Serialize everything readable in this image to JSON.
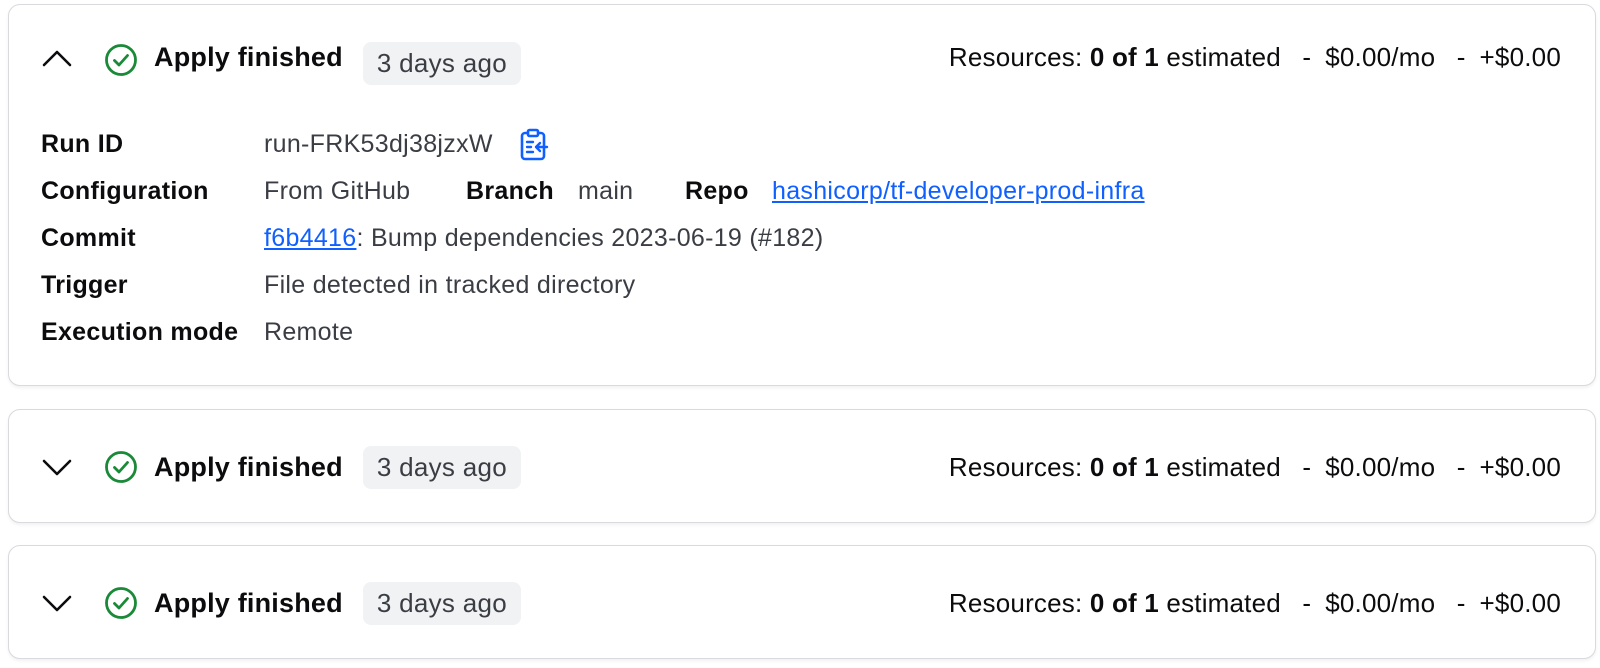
{
  "runs": [
    {
      "expanded": true,
      "status": "Apply finished",
      "time": "3 days ago",
      "resources": {
        "label": "Resources:",
        "count": "0 of 1",
        "estimated": "estimated",
        "sep": "-",
        "monthly": "$0.00/mo",
        "delta": "+$0.00"
      },
      "details": {
        "run_id_label": "Run ID",
        "run_id": "run-FRK53dj38jzxW",
        "configuration_label": "Configuration",
        "configuration": "From GitHub",
        "branch_label": "Branch",
        "branch": "main",
        "repo_label": "Repo",
        "repo": "hashicorp/tf-developer-prod-infra",
        "commit_label": "Commit",
        "commit_sha": "f6b4416",
        "commit_message": ": Bump dependencies 2023-06-19 (#182)",
        "trigger_label": "Trigger",
        "trigger": "File detected in tracked directory",
        "execution_mode_label": "Execution mode",
        "execution_mode": "Remote"
      }
    },
    {
      "expanded": false,
      "status": "Apply finished",
      "time": "3 days ago",
      "resources": {
        "label": "Resources:",
        "count": "0 of 1",
        "estimated": "estimated",
        "sep": "-",
        "monthly": "$0.00/mo",
        "delta": "+$0.00"
      }
    },
    {
      "expanded": false,
      "status": "Apply finished",
      "time": "3 days ago",
      "resources": {
        "label": "Resources:",
        "count": "0 of 1",
        "estimated": "estimated",
        "sep": "-",
        "monthly": "$0.00/mo",
        "delta": "+$0.00"
      }
    }
  ],
  "icons": {
    "chevron_up": "chevron-up-icon",
    "chevron_down": "chevron-down-icon",
    "status": "check-circle-icon",
    "copy": "clipboard-copy-icon"
  },
  "colors": {
    "success": "#1a8a38",
    "link": "#1060ff",
    "badge_bg": "#f1f2f3"
  }
}
